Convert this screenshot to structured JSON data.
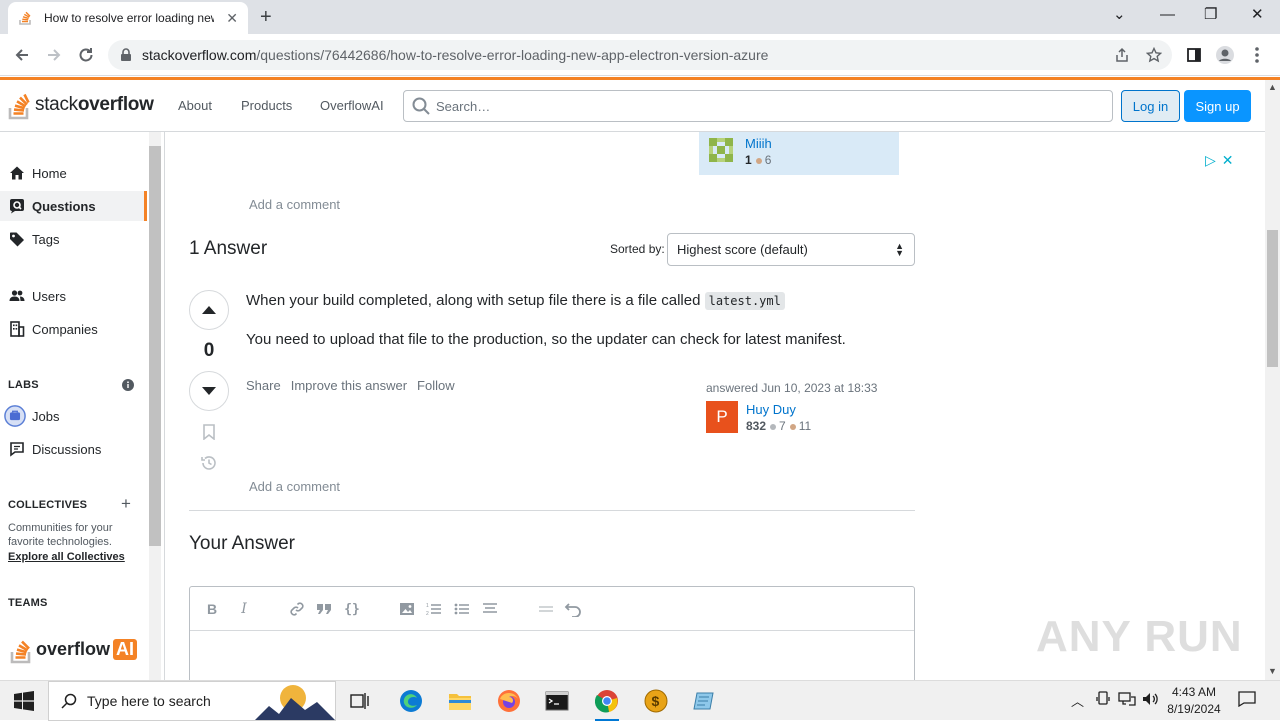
{
  "browser": {
    "tab_title": "How to resolve error loading new app electron version azure",
    "new_tab": "+",
    "url_host": "stackoverflow.com",
    "url_path": "/questions/76442686/how-to-resolve-error-loading-new-app-electron-version-azure"
  },
  "header": {
    "logo_light": "stack",
    "logo_bold": "overflow",
    "nav": [
      "About",
      "Products",
      "OverflowAI"
    ],
    "search_placeholder": "Search…",
    "login": "Log in",
    "signup": "Sign up"
  },
  "sidebar": {
    "items": [
      "Home",
      "Questions",
      "Tags",
      "Users",
      "Companies"
    ],
    "labs_heading": "LABS",
    "labs_items": [
      "Jobs",
      "Discussions"
    ],
    "collectives_heading": "COLLECTIVES",
    "collectives_text": "Communities for your favorite technologies.",
    "collectives_link": "Explore all Collectives",
    "teams_heading": "TEAMS",
    "overflow_ai_text": "overflow",
    "overflow_ai_badge": "AI"
  },
  "question_user": {
    "name": "Miiih",
    "rep": "1",
    "bronze": "6"
  },
  "answers": {
    "add_comment": "Add a comment",
    "count_label": "1 Answer",
    "sorted_by": "Sorted by:",
    "sort_value": "Highest score (default)",
    "vote_count": "0",
    "p1_text": "When your build completed, along with setup file there is a file called",
    "p1_code": "latest.yml",
    "p2_text": "You need to upload that file to the production, so the updater can check for latest manifest.",
    "menu": [
      "Share",
      "Improve this answer",
      "Follow"
    ],
    "answered_label": "answered",
    "answered_time": "Jun 10, 2023 at 18:33",
    "user_initial": "P",
    "user_name": "Huy Duy",
    "user_rep": "832",
    "user_silver": "7",
    "user_bronze": "11"
  },
  "your_answer": {
    "title": "Your Answer"
  },
  "watermark": "ANY RUN",
  "taskbar": {
    "search_placeholder": "Type here to search",
    "time": "4:43 AM",
    "date": "8/19/2024"
  },
  "colors": {
    "accent_orange": "#f48225",
    "link_blue": "#0074cc",
    "signup_blue": "#0a95ff",
    "avatar_orange": "#e8511c",
    "silver": "#b4b8bc",
    "bronze": "#d1a684"
  }
}
